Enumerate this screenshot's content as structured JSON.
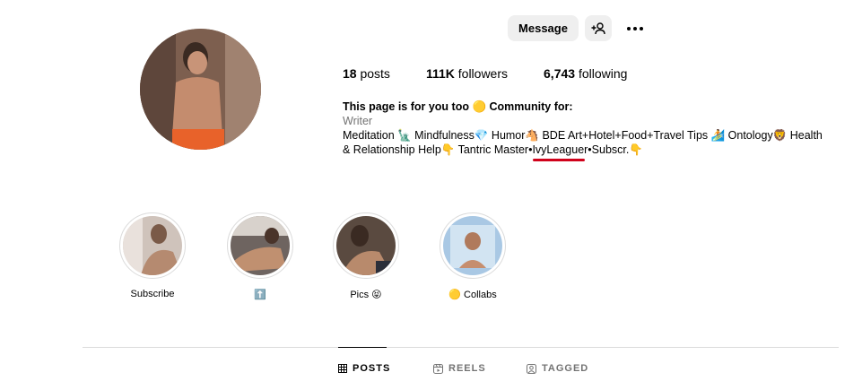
{
  "actions": {
    "message_label": "Message",
    "follow_icon": "person-add-icon",
    "more_icon": "more-options-icon"
  },
  "stats": {
    "posts_count": "18",
    "posts_label": "posts",
    "followers_count": "111K",
    "followers_label": "followers",
    "following_count": "6,743",
    "following_label": "following"
  },
  "bio": {
    "title": "This page is for you too 🟡 Community for:",
    "category": "Writer",
    "line1": "Meditation 🗽 Mindfulness💎 Humor🐴 BDE Art+Hotel+Food+Travel Tips 🏄 Ontology🦁 Health",
    "line2": "& Relationship Help👇 Tantric Master•IvyLeaguer•Subscr.👇"
  },
  "highlights": [
    {
      "label": "Subscribe"
    },
    {
      "label": "⬆️"
    },
    {
      "label": "Pics 😝"
    },
    {
      "label": "🟡 Collabs"
    }
  ],
  "tabs": {
    "posts": "POSTS",
    "reels": "REELS",
    "tagged": "TAGGED"
  },
  "colors": {
    "button_bg": "#efefef",
    "divider": "#dbdbdb",
    "muted_text": "#737373",
    "annotation_red": "#d0021b"
  }
}
